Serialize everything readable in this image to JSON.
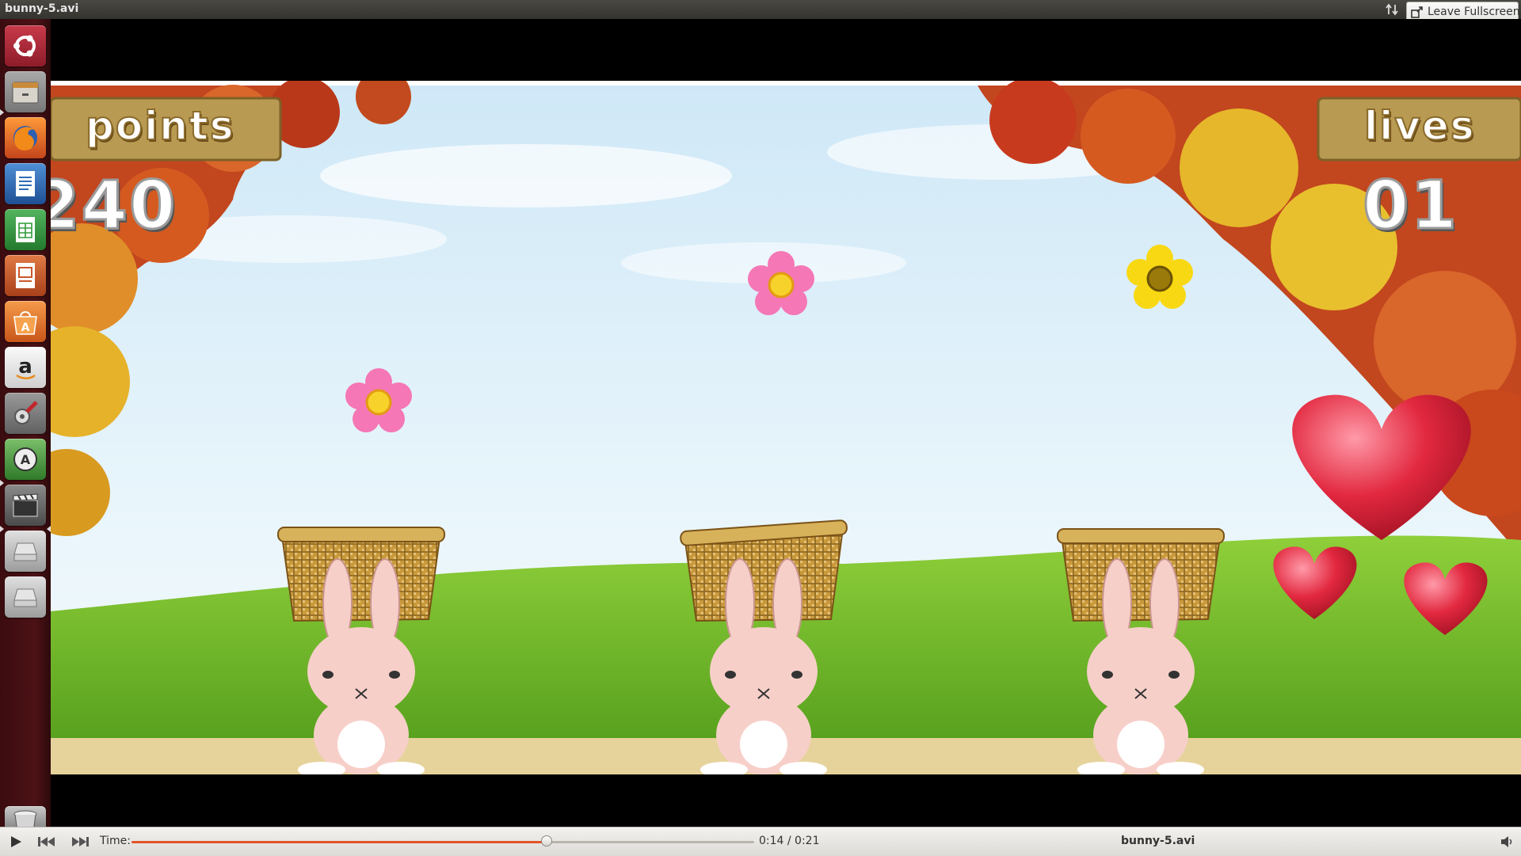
{
  "window": {
    "title": "bunny-5.avi"
  },
  "topbar": {
    "leave_fullscreen_label": "Leave Fullscreen"
  },
  "launcher": {
    "items": [
      {
        "name": "dash",
        "icon": "ubuntu-logo-icon",
        "color": "#b3263a"
      },
      {
        "name": "files",
        "icon": "file-manager-icon",
        "color": "#c98b3c"
      },
      {
        "name": "firefox",
        "icon": "firefox-icon",
        "color": "#e0762a"
      },
      {
        "name": "writer",
        "icon": "libreoffice-writer-icon",
        "color": "#2e6db4"
      },
      {
        "name": "calc",
        "icon": "libreoffice-calc-icon",
        "color": "#2f9a3a"
      },
      {
        "name": "impress",
        "icon": "libreoffice-impress-icon",
        "color": "#c9582a"
      },
      {
        "name": "software-center",
        "icon": "software-center-icon",
        "color": "#e8792a"
      },
      {
        "name": "amazon",
        "icon": "amazon-icon",
        "color": "#e7e7e7"
      },
      {
        "name": "system-settings",
        "icon": "settings-tools-icon",
        "color": "#8a2b2b"
      },
      {
        "name": "software-updater",
        "icon": "update-icon",
        "color": "#3f8f3a"
      },
      {
        "name": "videos",
        "icon": "video-player-icon",
        "color": "#5a5a5a"
      },
      {
        "name": "drive-1",
        "icon": "drive-icon",
        "color": "#bcbcbc"
      },
      {
        "name": "drive-2",
        "icon": "drive-icon",
        "color": "#bcbcbc"
      },
      {
        "name": "trash",
        "icon": "trash-icon",
        "color": "#8c8c8c"
      }
    ]
  },
  "game": {
    "points_label": "points",
    "points_value": "240",
    "lives_label": "lives",
    "lives_value": "01",
    "flowers": [
      {
        "color": "pink"
      },
      {
        "color": "yellow"
      },
      {
        "color": "pink"
      }
    ],
    "bunnies": 3
  },
  "player": {
    "time_label": "Time:",
    "time_value": "0:14 / 0:21",
    "progress": 0.6667,
    "file_name": "bunny-5.avi",
    "accent": "#e2552c"
  }
}
